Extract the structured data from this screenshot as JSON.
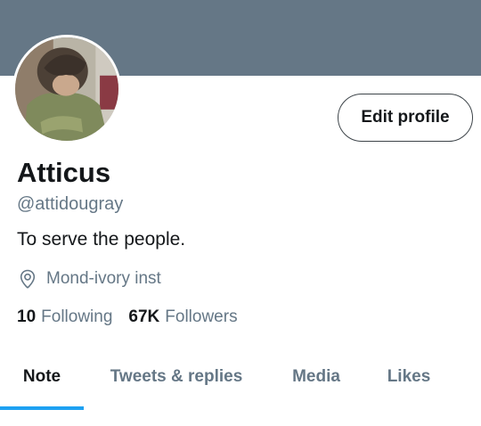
{
  "profile": {
    "name": "Atticus",
    "handle": "@attidougray",
    "bio": "To serve the people.",
    "location": "Mond-ivory inst",
    "edit_label": "Edit profile"
  },
  "stats": {
    "following_count": "10",
    "following_label": "Following",
    "followers_count": "67K",
    "followers_label": "Followers"
  },
  "tabs": [
    {
      "label": "Note",
      "active": true
    },
    {
      "label": "Tweets & replies",
      "active": false
    },
    {
      "label": "Media",
      "active": false
    },
    {
      "label": "Likes",
      "active": false
    }
  ],
  "colors": {
    "banner": "#657786",
    "accent": "#1da1f2",
    "secondary_text": "#657786"
  },
  "icons": {
    "location": "location-pin-icon"
  }
}
